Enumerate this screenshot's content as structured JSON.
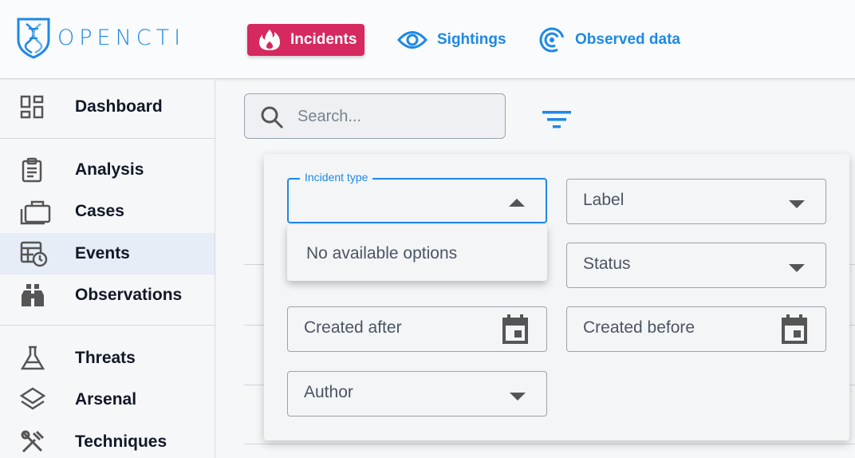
{
  "app": {
    "logo_text": "OPENCTI"
  },
  "topnav": [
    {
      "label": "Incidents",
      "icon": "flame-icon",
      "active": true
    },
    {
      "label": "Sightings",
      "icon": "eye-icon",
      "active": false
    },
    {
      "label": "Observed data",
      "icon": "radar-icon",
      "active": false
    }
  ],
  "sidebar": {
    "items": [
      {
        "label": "Dashboard",
        "icon": "dashboard-icon"
      },
      {
        "label": "Analysis",
        "icon": "clipboard-icon"
      },
      {
        "label": "Cases",
        "icon": "briefcase-icon"
      },
      {
        "label": "Events",
        "icon": "calendar-clock-icon",
        "active": true
      },
      {
        "label": "Observations",
        "icon": "binoculars-icon"
      },
      {
        "label": "Threats",
        "icon": "flask-icon"
      },
      {
        "label": "Arsenal",
        "icon": "layers-icon"
      },
      {
        "label": "Techniques",
        "icon": "tools-icon"
      }
    ]
  },
  "search": {
    "placeholder": "Search..."
  },
  "filters": {
    "incident_type": {
      "label": "Incident type",
      "no_options": "No available options"
    },
    "label": {
      "label": "Label"
    },
    "status": {
      "label": "Status"
    },
    "created_after": {
      "label": "Created after"
    },
    "created_before": {
      "label": "Created before"
    },
    "author": {
      "label": "Author"
    }
  },
  "colors": {
    "accent": "#1e88e5",
    "active_nav": "#d5295f"
  }
}
